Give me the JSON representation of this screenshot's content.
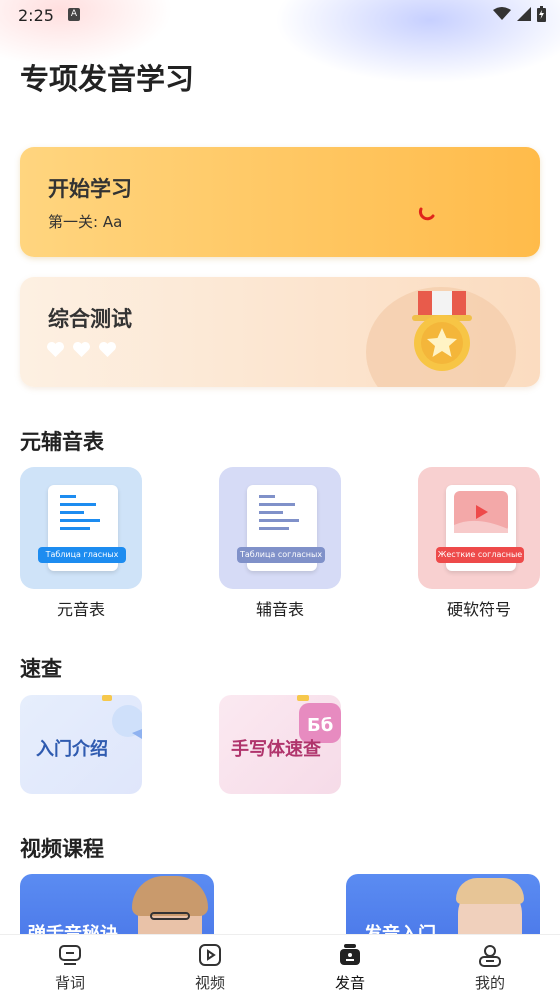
{
  "status": {
    "time": "2:25",
    "a_badge": "A"
  },
  "page": {
    "title": "专项发音学习"
  },
  "cards": {
    "start": {
      "title": "开始学习",
      "subtitle": "第一关: Aa"
    },
    "test": {
      "title": "综合测试",
      "hearts": 3
    }
  },
  "tables_section": {
    "title": "元辅音表",
    "items": [
      {
        "label": "元音表",
        "tag": "Таблица гласных",
        "color": "#cfe3f8",
        "tag_color": "#1d8cf0"
      },
      {
        "label": "辅音表",
        "tag": "Таблица согласных",
        "color": "#d6dbf6",
        "tag_color": "#8091c9"
      },
      {
        "label": "硬软符号",
        "tag": "Жесткие согласные",
        "color": "#f8d0d0",
        "tag_color": "#ee4a4a"
      }
    ]
  },
  "quick_section": {
    "title": "速查",
    "items": [
      {
        "label": "入门介绍",
        "color": "#2f5bb0"
      },
      {
        "label": "手写体速查",
        "color": "#b0346c"
      }
    ]
  },
  "video_section": {
    "title": "视频课程",
    "items": [
      {
        "label": "弹舌音秘诀"
      },
      {
        "label": "发音入门"
      }
    ]
  },
  "tabbar": {
    "items": [
      {
        "label": "背词",
        "icon": "word-book-icon"
      },
      {
        "label": "视频",
        "icon": "video-play-icon"
      },
      {
        "label": "发音",
        "icon": "pronunciation-icon",
        "active": true
      },
      {
        "label": "我的",
        "icon": "profile-icon"
      }
    ]
  }
}
